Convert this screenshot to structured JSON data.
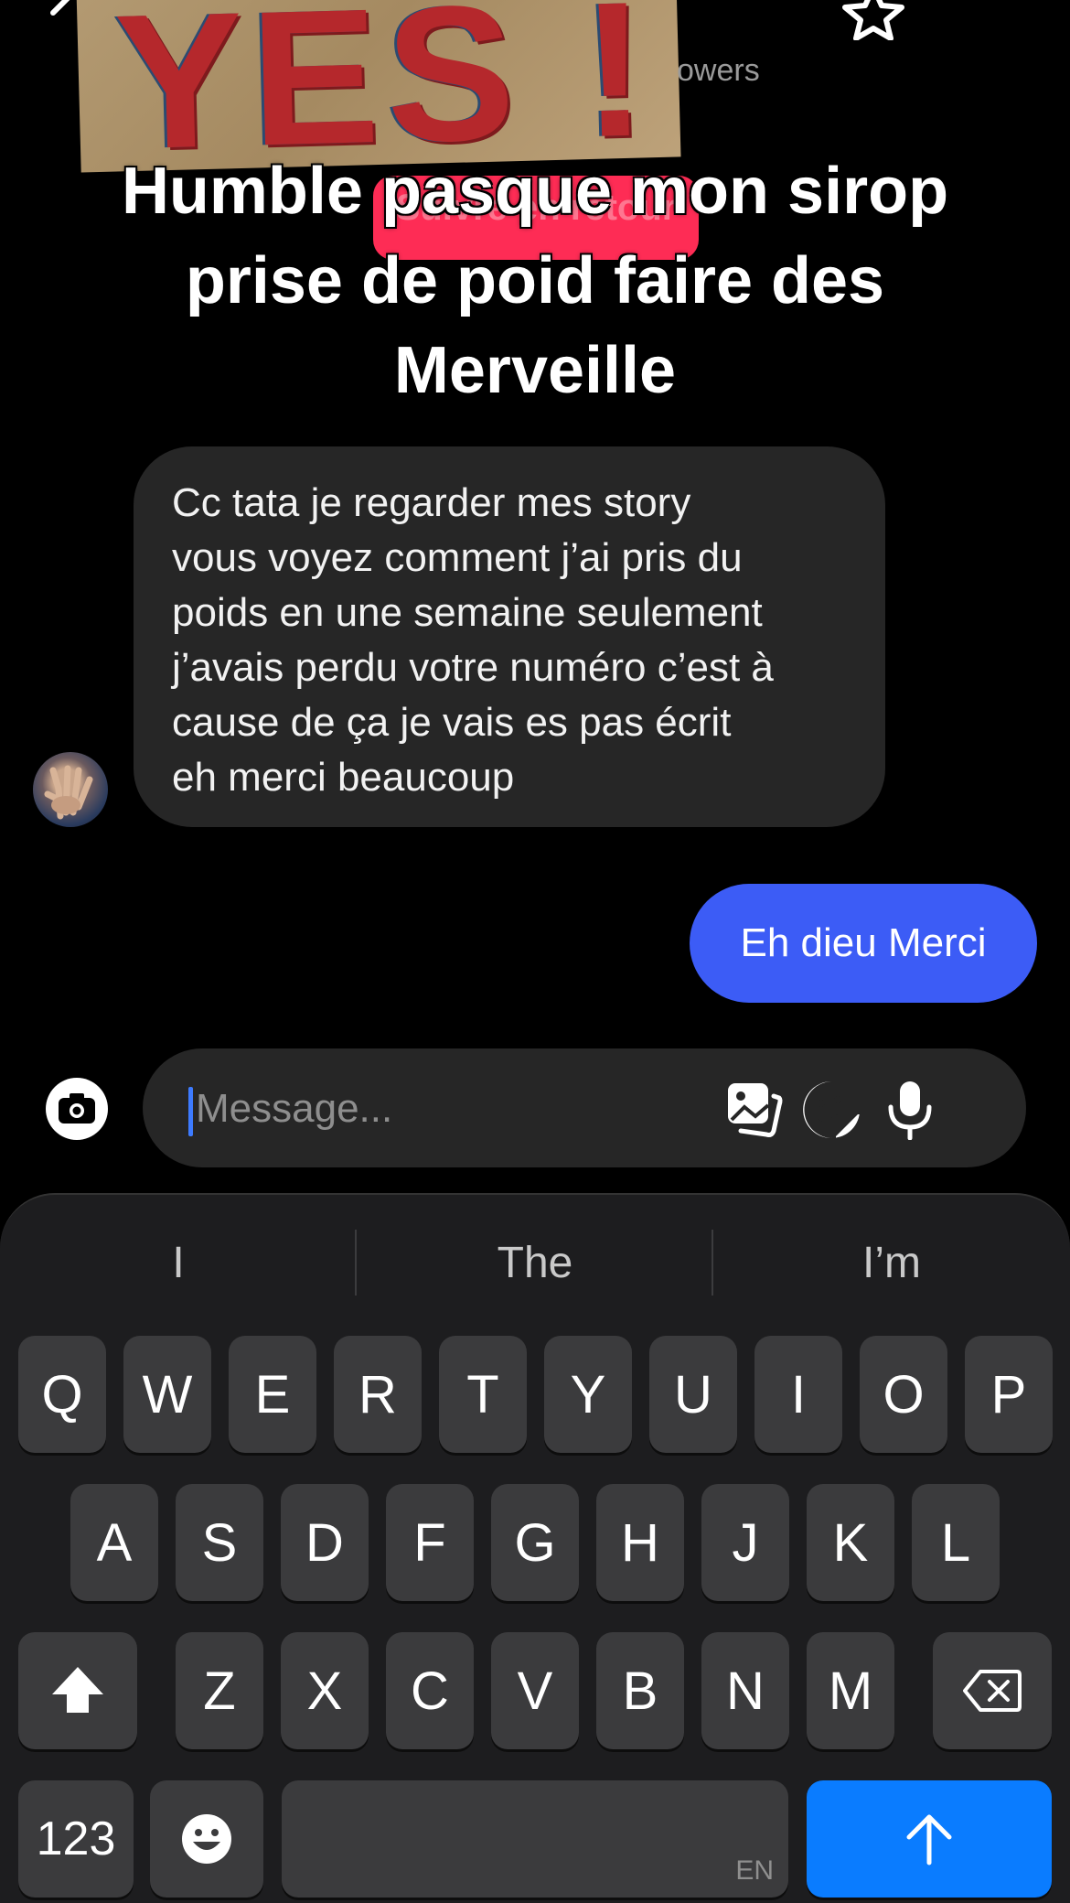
{
  "header": {
    "sticker_word": "YES !",
    "followers_fragment": "owers",
    "caption": "Humble pasque mon sirop prise de poid faire des Merveille",
    "pill_label": "Suivre en retour",
    "icons": {
      "back": "chevron-left-icon",
      "star": "star-icon",
      "more": "more-icon"
    }
  },
  "conversation": {
    "incoming": {
      "avatar": "avatar",
      "text": "Cc tata je regarder mes story\nvous voyez comment j’ai pris du\npoids en une semaine seulement\nj’avais perdu votre numéro c’est à\ncause de ça je vais es pas écrit\neh merci beaucoup"
    },
    "outgoing": {
      "text": "Eh dieu Merci"
    }
  },
  "composer": {
    "placeholder": "Message...",
    "value": "",
    "icons": [
      "camera-icon",
      "gallery-icon",
      "sticker-icon",
      "microphone-icon"
    ]
  },
  "keyboard": {
    "suggestions": [
      "I",
      "The",
      "I’m"
    ],
    "row1": [
      "Q",
      "W",
      "E",
      "R",
      "T",
      "Y",
      "U",
      "I",
      "O",
      "P"
    ],
    "row2": [
      "A",
      "S",
      "D",
      "F",
      "G",
      "H",
      "J",
      "K",
      "L"
    ],
    "row3": [
      "Z",
      "X",
      "C",
      "V",
      "B",
      "N",
      "M"
    ],
    "numbers_label": "123",
    "space_lang": "EN",
    "icons": {
      "shift": "shift-icon",
      "backspace": "backspace-icon",
      "emoji": "emoji-icon",
      "send": "send-arrow-icon"
    }
  },
  "colors": {
    "background": "#000000",
    "bubble_incoming": "#262626",
    "bubble_outgoing": "#3c5cf6",
    "send_key": "#0a7cff",
    "caret": "#3d7bff",
    "pill": "#fe2c55"
  }
}
